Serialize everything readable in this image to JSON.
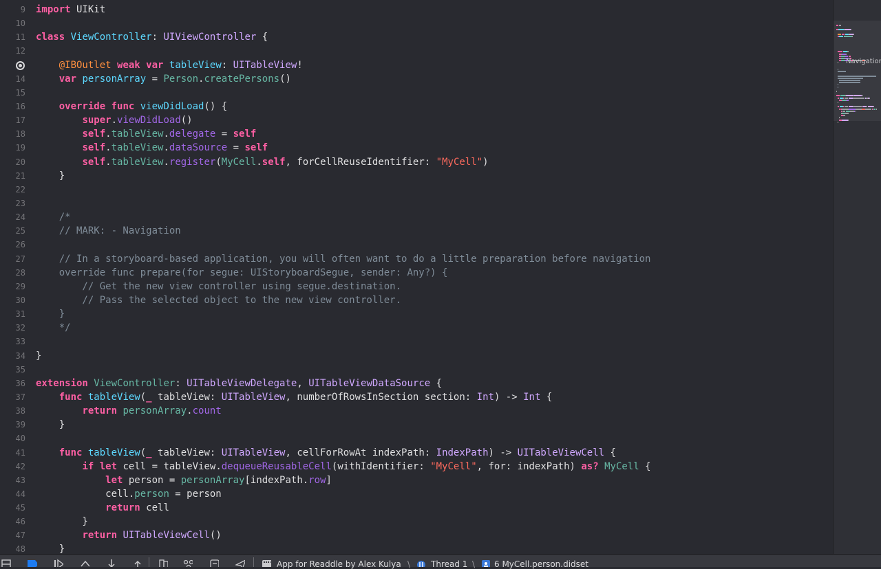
{
  "editor": {
    "lines": [
      {
        "n": "9",
        "t": [
          [
            "kw",
            "import"
          ],
          [
            "pl",
            " UIKit"
          ]
        ]
      },
      {
        "n": "10",
        "t": []
      },
      {
        "n": "11",
        "t": [
          [
            "kw",
            "class"
          ],
          [
            "pl",
            " "
          ],
          [
            "pt",
            "ViewController"
          ],
          [
            "pl",
            ": "
          ],
          [
            "ty",
            "UIViewController"
          ],
          [
            "pl",
            " {"
          ]
        ]
      },
      {
        "n": "12",
        "t": []
      },
      {
        "n": "",
        "breakpoint": true,
        "t": [
          [
            "pl",
            "    "
          ],
          [
            "at",
            "@IBOutlet"
          ],
          [
            "pl",
            " "
          ],
          [
            "kw",
            "weak"
          ],
          [
            "pl",
            " "
          ],
          [
            "kw",
            "var"
          ],
          [
            "pl",
            " "
          ],
          [
            "pt",
            "tableView"
          ],
          [
            "pl",
            ": "
          ],
          [
            "ty",
            "UITableView"
          ],
          [
            "pl",
            "!"
          ]
        ]
      },
      {
        "n": "14",
        "t": [
          [
            "pl",
            "    "
          ],
          [
            "kw",
            "var"
          ],
          [
            "pl",
            " "
          ],
          [
            "pt",
            "personArray"
          ],
          [
            "pl",
            " = "
          ],
          [
            "pm",
            "Person"
          ],
          [
            "pl",
            "."
          ],
          [
            "pm",
            "createPersons"
          ],
          [
            "pl",
            "()"
          ]
        ]
      },
      {
        "n": "15",
        "t": []
      },
      {
        "n": "16",
        "t": [
          [
            "pl",
            "    "
          ],
          [
            "kw",
            "override"
          ],
          [
            "pl",
            " "
          ],
          [
            "kw",
            "func"
          ],
          [
            "pl",
            " "
          ],
          [
            "pt",
            "viewDidLoad"
          ],
          [
            "pl",
            "() {"
          ]
        ]
      },
      {
        "n": "17",
        "t": [
          [
            "pl",
            "        "
          ],
          [
            "kw",
            "super"
          ],
          [
            "pl",
            "."
          ],
          [
            "ot",
            "viewDidLoad"
          ],
          [
            "pl",
            "()"
          ]
        ]
      },
      {
        "n": "18",
        "t": [
          [
            "pl",
            "        "
          ],
          [
            "kw",
            "self"
          ],
          [
            "pl",
            "."
          ],
          [
            "pm",
            "tableView"
          ],
          [
            "pl",
            "."
          ],
          [
            "ot",
            "delegate"
          ],
          [
            "pl",
            " = "
          ],
          [
            "kw",
            "self"
          ]
        ]
      },
      {
        "n": "19",
        "t": [
          [
            "pl",
            "        "
          ],
          [
            "kw",
            "self"
          ],
          [
            "pl",
            "."
          ],
          [
            "pm",
            "tableView"
          ],
          [
            "pl",
            "."
          ],
          [
            "ot",
            "dataSource"
          ],
          [
            "pl",
            " = "
          ],
          [
            "kw",
            "self"
          ]
        ]
      },
      {
        "n": "20",
        "t": [
          [
            "pl",
            "        "
          ],
          [
            "kw",
            "self"
          ],
          [
            "pl",
            "."
          ],
          [
            "pm",
            "tableView"
          ],
          [
            "pl",
            "."
          ],
          [
            "ot",
            "register"
          ],
          [
            "pl",
            "("
          ],
          [
            "pm",
            "MyCell"
          ],
          [
            "pl",
            "."
          ],
          [
            "kw",
            "self"
          ],
          [
            "pl",
            ", forCellReuseIdentifier: "
          ],
          [
            "st",
            "\"MyCell\""
          ],
          [
            "pl",
            ")"
          ]
        ]
      },
      {
        "n": "21",
        "t": [
          [
            "pl",
            "    }"
          ]
        ]
      },
      {
        "n": "22",
        "t": []
      },
      {
        "n": "23",
        "t": []
      },
      {
        "n": "24",
        "t": [
          [
            "cm",
            "    /*"
          ]
        ]
      },
      {
        "n": "25",
        "t": [
          [
            "cm",
            "    // MARK: - Navigation"
          ]
        ]
      },
      {
        "n": "26",
        "t": []
      },
      {
        "n": "27",
        "t": [
          [
            "cm",
            "    // In a storyboard-based application, you will often want to do a little preparation before navigation"
          ]
        ]
      },
      {
        "n": "28",
        "t": [
          [
            "cm",
            "    override func prepare(for segue: UIStoryboardSegue, sender: Any?) {"
          ]
        ]
      },
      {
        "n": "29",
        "t": [
          [
            "cm",
            "        // Get the new view controller using segue.destination."
          ]
        ]
      },
      {
        "n": "30",
        "t": [
          [
            "cm",
            "        // Pass the selected object to the new view controller."
          ]
        ]
      },
      {
        "n": "31",
        "t": [
          [
            "cm",
            "    }"
          ]
        ]
      },
      {
        "n": "32",
        "t": [
          [
            "cm",
            "    */"
          ]
        ]
      },
      {
        "n": "33",
        "t": []
      },
      {
        "n": "34",
        "t": [
          [
            "pl",
            "}"
          ]
        ]
      },
      {
        "n": "35",
        "t": []
      },
      {
        "n": "36",
        "t": [
          [
            "kw",
            "extension"
          ],
          [
            "pl",
            " "
          ],
          [
            "pm",
            "ViewController"
          ],
          [
            "pl",
            ": "
          ],
          [
            "ty",
            "UITableViewDelegate"
          ],
          [
            "pl",
            ", "
          ],
          [
            "ty",
            "UITableViewDataSource"
          ],
          [
            "pl",
            " {"
          ]
        ]
      },
      {
        "n": "37",
        "t": [
          [
            "pl",
            "    "
          ],
          [
            "kw",
            "func"
          ],
          [
            "pl",
            " "
          ],
          [
            "pt",
            "tableView"
          ],
          [
            "pl",
            "("
          ],
          [
            "kw",
            "_"
          ],
          [
            "pl",
            " tableView: "
          ],
          [
            "ty",
            "UITableView"
          ],
          [
            "pl",
            ", numberOfRowsInSection section: "
          ],
          [
            "ty",
            "Int"
          ],
          [
            "pl",
            ") -> "
          ],
          [
            "ty",
            "Int"
          ],
          [
            "pl",
            " {"
          ]
        ]
      },
      {
        "n": "38",
        "t": [
          [
            "pl",
            "        "
          ],
          [
            "kw",
            "return"
          ],
          [
            "pl",
            " "
          ],
          [
            "pm",
            "personArray"
          ],
          [
            "pl",
            "."
          ],
          [
            "ot",
            "count"
          ]
        ]
      },
      {
        "n": "39",
        "t": [
          [
            "pl",
            "    }"
          ]
        ]
      },
      {
        "n": "40",
        "t": []
      },
      {
        "n": "41",
        "t": [
          [
            "pl",
            "    "
          ],
          [
            "kw",
            "func"
          ],
          [
            "pl",
            " "
          ],
          [
            "pt",
            "tableView"
          ],
          [
            "pl",
            "("
          ],
          [
            "kw",
            "_"
          ],
          [
            "pl",
            " tableView: "
          ],
          [
            "ty",
            "UITableView"
          ],
          [
            "pl",
            ", cellForRowAt indexPath: "
          ],
          [
            "ty",
            "IndexPath"
          ],
          [
            "pl",
            ") -> "
          ],
          [
            "ty",
            "UITableViewCell"
          ],
          [
            "pl",
            " {"
          ]
        ]
      },
      {
        "n": "42",
        "t": [
          [
            "pl",
            "        "
          ],
          [
            "kw",
            "if"
          ],
          [
            "pl",
            " "
          ],
          [
            "kw",
            "let"
          ],
          [
            "pl",
            " cell = tableView."
          ],
          [
            "ot",
            "dequeueReusableCell"
          ],
          [
            "pl",
            "(withIdentifier: "
          ],
          [
            "st",
            "\"MyCell\""
          ],
          [
            "pl",
            ", for: indexPath) "
          ],
          [
            "kw",
            "as?"
          ],
          [
            "pl",
            " "
          ],
          [
            "pm",
            "MyCell"
          ],
          [
            "pl",
            " {"
          ]
        ]
      },
      {
        "n": "43",
        "t": [
          [
            "pl",
            "            "
          ],
          [
            "kw",
            "let"
          ],
          [
            "pl",
            " person = "
          ],
          [
            "pm",
            "personArray"
          ],
          [
            "pl",
            "[indexPath."
          ],
          [
            "ot",
            "row"
          ],
          [
            "pl",
            "]"
          ]
        ]
      },
      {
        "n": "44",
        "t": [
          [
            "pl",
            "            cell."
          ],
          [
            "pm",
            "person"
          ],
          [
            "pl",
            " = person"
          ]
        ]
      },
      {
        "n": "45",
        "t": [
          [
            "pl",
            "            "
          ],
          [
            "kw",
            "return"
          ],
          [
            "pl",
            " cell"
          ]
        ]
      },
      {
        "n": "46",
        "t": [
          [
            "pl",
            "        }"
          ]
        ]
      },
      {
        "n": "47",
        "t": [
          [
            "pl",
            "        "
          ],
          [
            "kw",
            "return"
          ],
          [
            "pl",
            " "
          ],
          [
            "ty",
            "UITableViewCell"
          ],
          [
            "pl",
            "()"
          ]
        ]
      },
      {
        "n": "48",
        "t": [
          [
            "pl",
            "    }"
          ]
        ]
      }
    ]
  },
  "minimap": {
    "mark_label": "Navigation"
  },
  "debug_bar": {
    "scheme": "App for Readdle by Alex Kulya",
    "thread": "Thread 1",
    "frame": "6 MyCell.person.didset"
  }
}
